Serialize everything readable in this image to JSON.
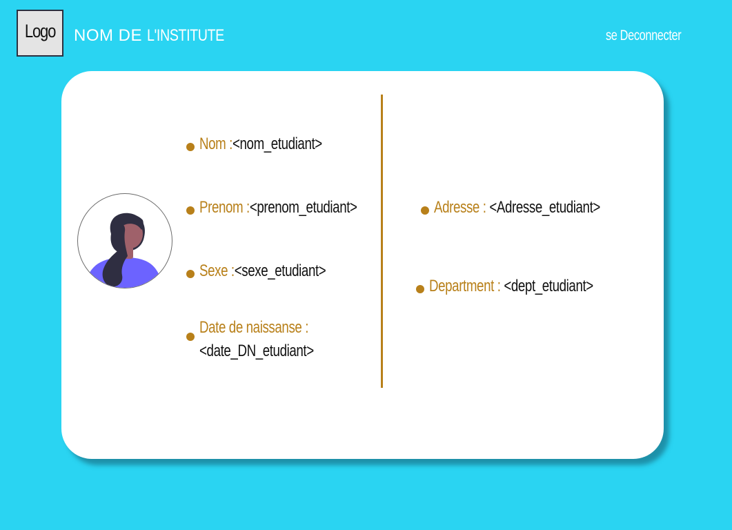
{
  "header": {
    "logo_text": "Logo",
    "institute_name_part1": "NOM DE ",
    "institute_name_part2": "L'INSTITUTE",
    "logout_label": "se Deconnecter"
  },
  "profile": {
    "avatar_icon": "female-user-avatar-icon",
    "accent_color": "#b8801a",
    "left_fields": [
      {
        "label": "Nom :",
        "value": "<nom_etudiant>"
      },
      {
        "label": "Prenom :",
        "value": "<prenom_etudiant>"
      },
      {
        "label": "Sexe :",
        "value": "<sexe_etudiant>"
      },
      {
        "label": "Date de naissanse :",
        "value": "<date_DN_etudiant>"
      }
    ],
    "right_fields": [
      {
        "label": "Adresse : ",
        "value": "<Adresse_etudiant>"
      },
      {
        "label": "Department : ",
        "value": "<dept_etudiant>"
      }
    ]
  },
  "colors": {
    "background": "#2ad4f2",
    "card": "#ffffff",
    "accent": "#b8801a"
  }
}
